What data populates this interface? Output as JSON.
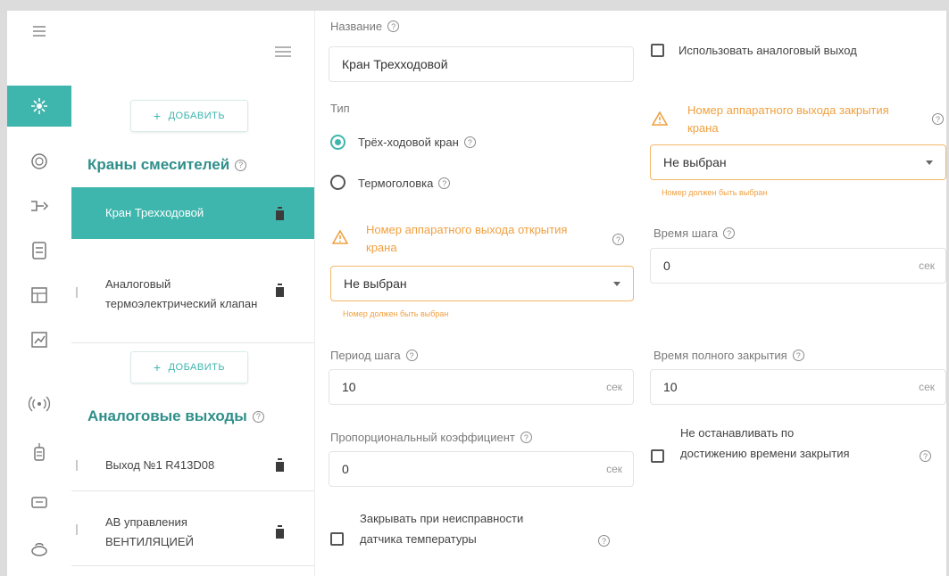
{
  "colors": {
    "accent": "#3fb6ad",
    "accent_text": "#2f8f8a",
    "warning": "#f0a040"
  },
  "rail": {
    "icons": [
      "menu-icon",
      "sensor-icon",
      "gauge-icon",
      "valve-icon",
      "controller-icon",
      "schedule-icon",
      "chart-icon",
      "radio-icon",
      "thermostat-icon",
      "display-icon",
      "boiler-icon"
    ]
  },
  "list": {
    "add_label": "ДОБАВИТЬ",
    "section1": {
      "title": "Краны смесителей",
      "items": [
        "Кран Трехходовой",
        "Аналоговый термоэлектрический клапан"
      ]
    },
    "section2": {
      "title": "Аналоговые выходы",
      "items": [
        "Выход №1 R413D08",
        "АВ управления ВЕНТИЛЯЦИЕЙ"
      ]
    }
  },
  "form": {
    "name_label": "Название",
    "name_value": "Кран Трехходовой",
    "type_label": "Тип",
    "type_options": [
      "Трёх-ходовой кран",
      "Термоголовка"
    ],
    "type_selected": "Трёх-ходовой кран",
    "open_output_label": "Номер аппаратного выхода открытия крана",
    "open_output_value": "Не выбран",
    "open_output_hint": "Номер должен быть выбран",
    "step_period_label": "Период шага",
    "step_period_value": "10",
    "unit_sec": "сек",
    "prop_coeff_label": "Пропорциональный коэффициент",
    "prop_coeff_value": "0",
    "close_on_fault_label": "Закрывать при неисправности датчика температуры",
    "use_analog_label": "Использовать аналоговый выход",
    "close_output_label": "Номер аппаратного выхода закрытия крана",
    "close_output_value": "Не выбран",
    "close_output_hint": "Номер должен быть выбран",
    "step_time_label": "Время шага",
    "step_time_value": "0",
    "full_close_label": "Время полного закрытия",
    "full_close_value": "10",
    "no_stop_label": "Не останавливать по достижению времени закрытия"
  }
}
